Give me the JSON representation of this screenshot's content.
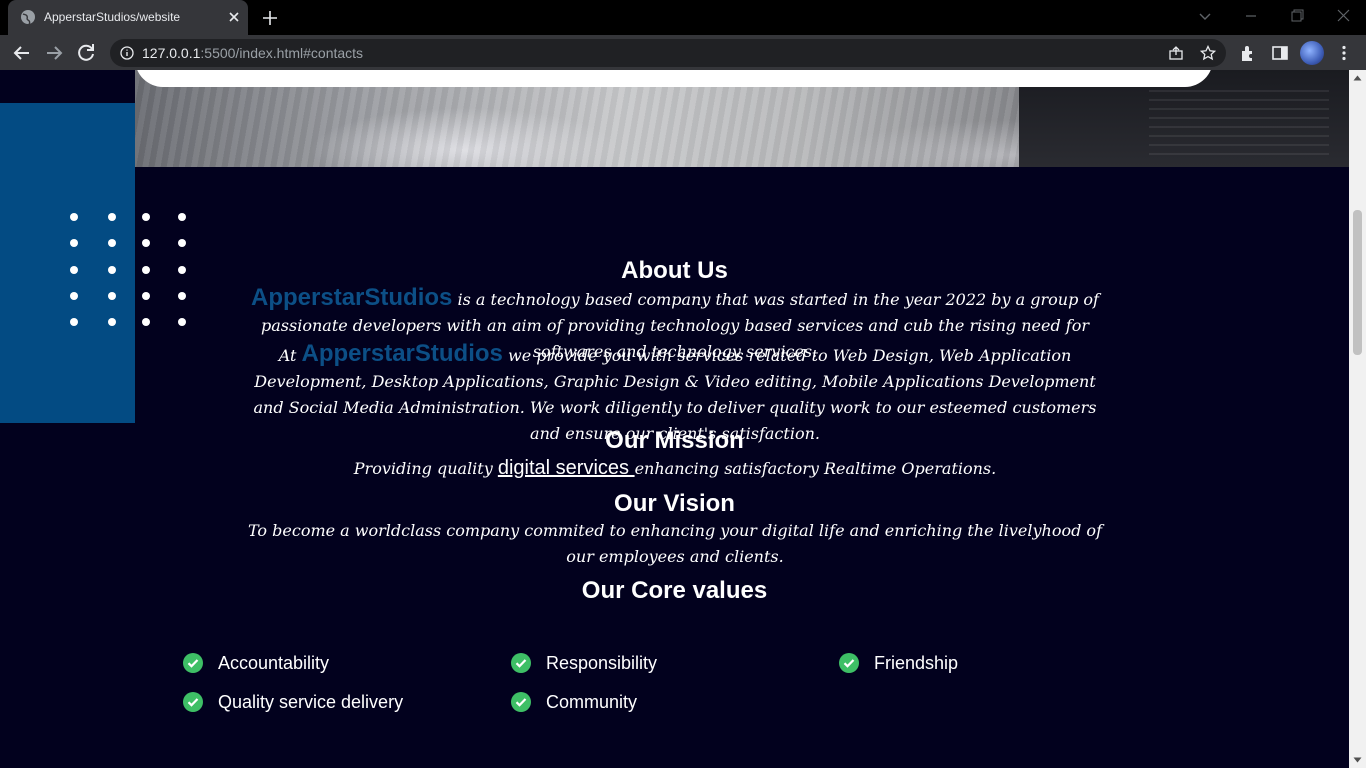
{
  "browser": {
    "tab_title": "ApperstarStudios/website",
    "url_host": "127.0.0.1",
    "url_rest": ":5500/index.html#contacts"
  },
  "about": {
    "heading": "About Us",
    "brand": "ApperstarStudios",
    "p1_text": " is a technology based company that was started in the year 2022 by a group of passionate developers with an aim of providing technology based services and cub the rising need for softwares and technology services.",
    "p2_prefix": "At ",
    "p2_text": " we provide you with services related to Web Design, Web Application Development, Desktop Applications, Graphic Design & Video editing, Mobile Applications Development and Social Media Administration. We work diligently to deliver quality work to our esteemed customers and ensure our client's satisfaction."
  },
  "mission": {
    "heading": "Our Mission",
    "prefix": "Providing quality ",
    "link": "digital services ",
    "suffix": "enhancing satisfactory Realtime Operations."
  },
  "vision": {
    "heading": "Our Vision",
    "text": "To become a worldclass company commited to enhancing your digital life and enriching the livelyhood of our employees and clients."
  },
  "core_values": {
    "heading": "Our Core values",
    "items": [
      "Accountability",
      "Responsibility",
      "Friendship",
      "Quality service delivery",
      "Community"
    ]
  },
  "colors": {
    "page_bg": "#02011e",
    "brand_blue": "#0c4f86",
    "block_blue": "#034b83",
    "check_green": "#3ebf66"
  }
}
